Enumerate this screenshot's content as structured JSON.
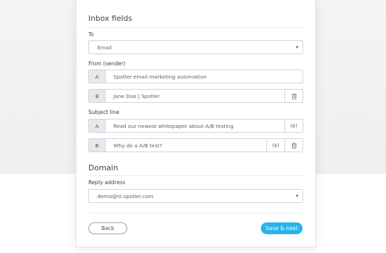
{
  "inbox_fields": {
    "title": "Inbox fields",
    "to": {
      "label": "To",
      "value": "Email"
    },
    "from": {
      "label": "From (sender)",
      "variants": [
        {
          "tag": "A",
          "value": "Spotler email marketing automation"
        },
        {
          "tag": "B",
          "value": "Jane Doe | Spotler"
        }
      ]
    },
    "subject": {
      "label": "Subject line",
      "personalize_label": "(p)",
      "variants": [
        {
          "tag": "A",
          "value": "Read our newest whitepaper about A/B testing"
        },
        {
          "tag": "B",
          "value": "Why do a A/B test?"
        }
      ]
    }
  },
  "domain": {
    "title": "Domain",
    "reply": {
      "label": "Reply address",
      "value": "demo@nl.spotler.com"
    }
  },
  "footer": {
    "back_label": "Back",
    "next_label": "Save & next"
  },
  "colors": {
    "accent": "#27b4ec",
    "variant_bg": "#e6e8eb"
  }
}
